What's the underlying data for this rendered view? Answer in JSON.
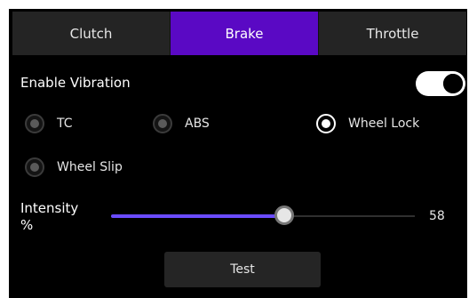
{
  "tabs": [
    {
      "label": "Clutch",
      "active": false
    },
    {
      "label": "Brake",
      "active": true
    },
    {
      "label": "Throttle",
      "active": false
    }
  ],
  "vibration": {
    "label": "Enable Vibration",
    "enabled": true
  },
  "options": [
    {
      "label": "TC",
      "checked": false
    },
    {
      "label": "ABS",
      "checked": false
    },
    {
      "label": "Wheel Lock",
      "checked": true
    },
    {
      "label": "Wheel Slip",
      "checked": false
    }
  ],
  "intensity": {
    "label_line1": "Intensity",
    "label_line2": "%",
    "value": 58,
    "value_text": "58",
    "min": 0,
    "max": 100
  },
  "test_button": {
    "label": "Test"
  },
  "colors": {
    "accent": "#5a09c4",
    "slider": "#6a4bff",
    "tab_bg": "#242424"
  }
}
